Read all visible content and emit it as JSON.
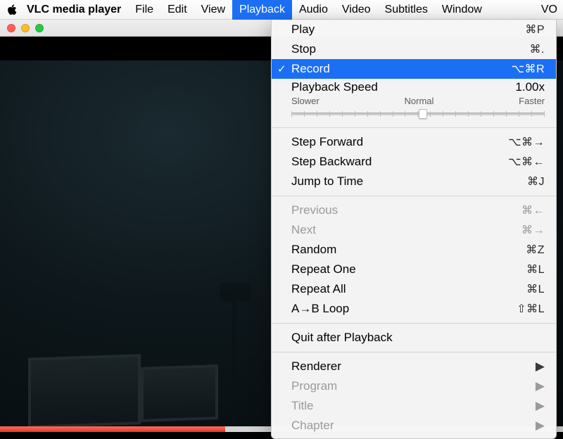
{
  "menubar": {
    "appname": "VLC media player",
    "items": [
      "File",
      "Edit",
      "View",
      "Playback",
      "Audio",
      "Video",
      "Subtitles",
      "Window"
    ],
    "active": "Playback",
    "truncated_right": "VO"
  },
  "dropdown": {
    "play": {
      "label": "Play",
      "shortcut": "⌘P"
    },
    "stop": {
      "label": "Stop",
      "shortcut": "⌘."
    },
    "record": {
      "label": "Record",
      "shortcut": "⌥⌘R",
      "checked": true
    },
    "speed": {
      "title": "Playback Speed",
      "value": "1.00x",
      "slower": "Slower",
      "normal": "Normal",
      "faster": "Faster",
      "position_pct": 52
    },
    "step_forward": {
      "label": "Step Forward",
      "shortcut": "⌥⌘→"
    },
    "step_backward": {
      "label": "Step Backward",
      "shortcut": "⌥⌘←"
    },
    "jump": {
      "label": "Jump to Time",
      "shortcut": "⌘J"
    },
    "previous": {
      "label": "Previous",
      "shortcut": "⌘←"
    },
    "next": {
      "label": "Next",
      "shortcut": "⌘→"
    },
    "random": {
      "label": "Random",
      "shortcut": "⌘Z"
    },
    "repeat_one": {
      "label": "Repeat One",
      "shortcut": "⌘L"
    },
    "repeat_all": {
      "label": "Repeat All",
      "shortcut": "⌘L"
    },
    "ab_loop": {
      "label": "A→B Loop",
      "shortcut": "⇧⌘L"
    },
    "quit_after": {
      "label": "Quit after Playback"
    },
    "renderer": {
      "label": "Renderer"
    },
    "program": {
      "label": "Program"
    },
    "title": {
      "label": "Title"
    },
    "chapter": {
      "label": "Chapter"
    }
  }
}
